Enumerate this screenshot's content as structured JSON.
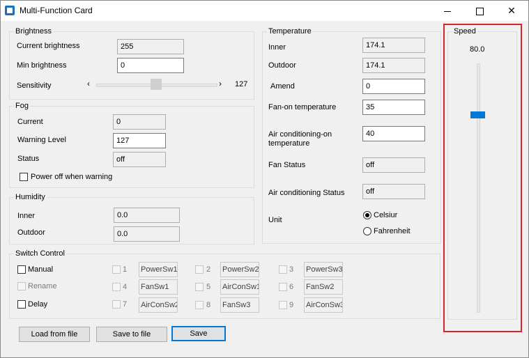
{
  "window": {
    "title": "Multi-Function Card",
    "minimize_icon": "minimize-icon",
    "maximize_icon": "maximize-icon",
    "close_icon": "close-icon"
  },
  "brightness": {
    "legend": "Brightness",
    "current_label": "Current brightness",
    "current_value": "255",
    "min_label": "Min brightness",
    "min_value": "0",
    "sensitivity_label": "Sensitivity",
    "sensitivity_value": "127",
    "left_arrow": "‹",
    "right_arrow": "›",
    "sensitivity_min": 0,
    "sensitivity_max": 255
  },
  "fog": {
    "legend": "Fog",
    "current_label": "Current",
    "current_value": "0",
    "warning_label": "Warning Level",
    "warning_value": "127",
    "status_label": "Status",
    "status_value": "off",
    "poweroff_label": "Power off when warning",
    "poweroff_checked": false
  },
  "humidity": {
    "legend": "Humidity",
    "inner_label": "Inner",
    "inner_value": "0.0",
    "outdoor_label": "Outdoor",
    "outdoor_value": "0.0"
  },
  "temperature": {
    "legend": "Temperature",
    "inner_label": "Inner",
    "inner_value": "174.1",
    "outdoor_label": "Outdoor",
    "outdoor_value": "174.1",
    "amend_label": "Amend",
    "amend_value": "0",
    "fanon_label": "Fan-on temperature",
    "fanon_value": "35",
    "acon_label": "Air conditioning-on temperature",
    "acon_value": "40",
    "fanstatus_label": "Fan Status",
    "fanstatus_value": "off",
    "acstatus_label": "Air conditioning Status",
    "acstatus_value": "off",
    "unit_label": "Unit",
    "unit_celsius": "Celsiur",
    "unit_fahrenheit": "Fahrenheit",
    "unit_selected": "celsius"
  },
  "speed": {
    "legend": "Speed",
    "value": "80.0",
    "min": 0,
    "max": 100
  },
  "switch_control": {
    "legend": "Switch Control",
    "manual_label": "Manual",
    "rename_label": "Rename",
    "delay_label": "Delay",
    "switches": [
      {
        "num": "1",
        "name": "PowerSw1"
      },
      {
        "num": "2",
        "name": "PowerSw2"
      },
      {
        "num": "3",
        "name": "PowerSw3"
      },
      {
        "num": "4",
        "name": "FanSw1"
      },
      {
        "num": "5",
        "name": "AirConSw1"
      },
      {
        "num": "6",
        "name": "FanSw2"
      },
      {
        "num": "7",
        "name": "AirConSw2"
      },
      {
        "num": "8",
        "name": "FanSw3"
      },
      {
        "num": "9",
        "name": "AirConSw3"
      }
    ]
  },
  "buttons": {
    "load": "Load from file",
    "save_to_file": "Save to file",
    "save": "Save"
  }
}
